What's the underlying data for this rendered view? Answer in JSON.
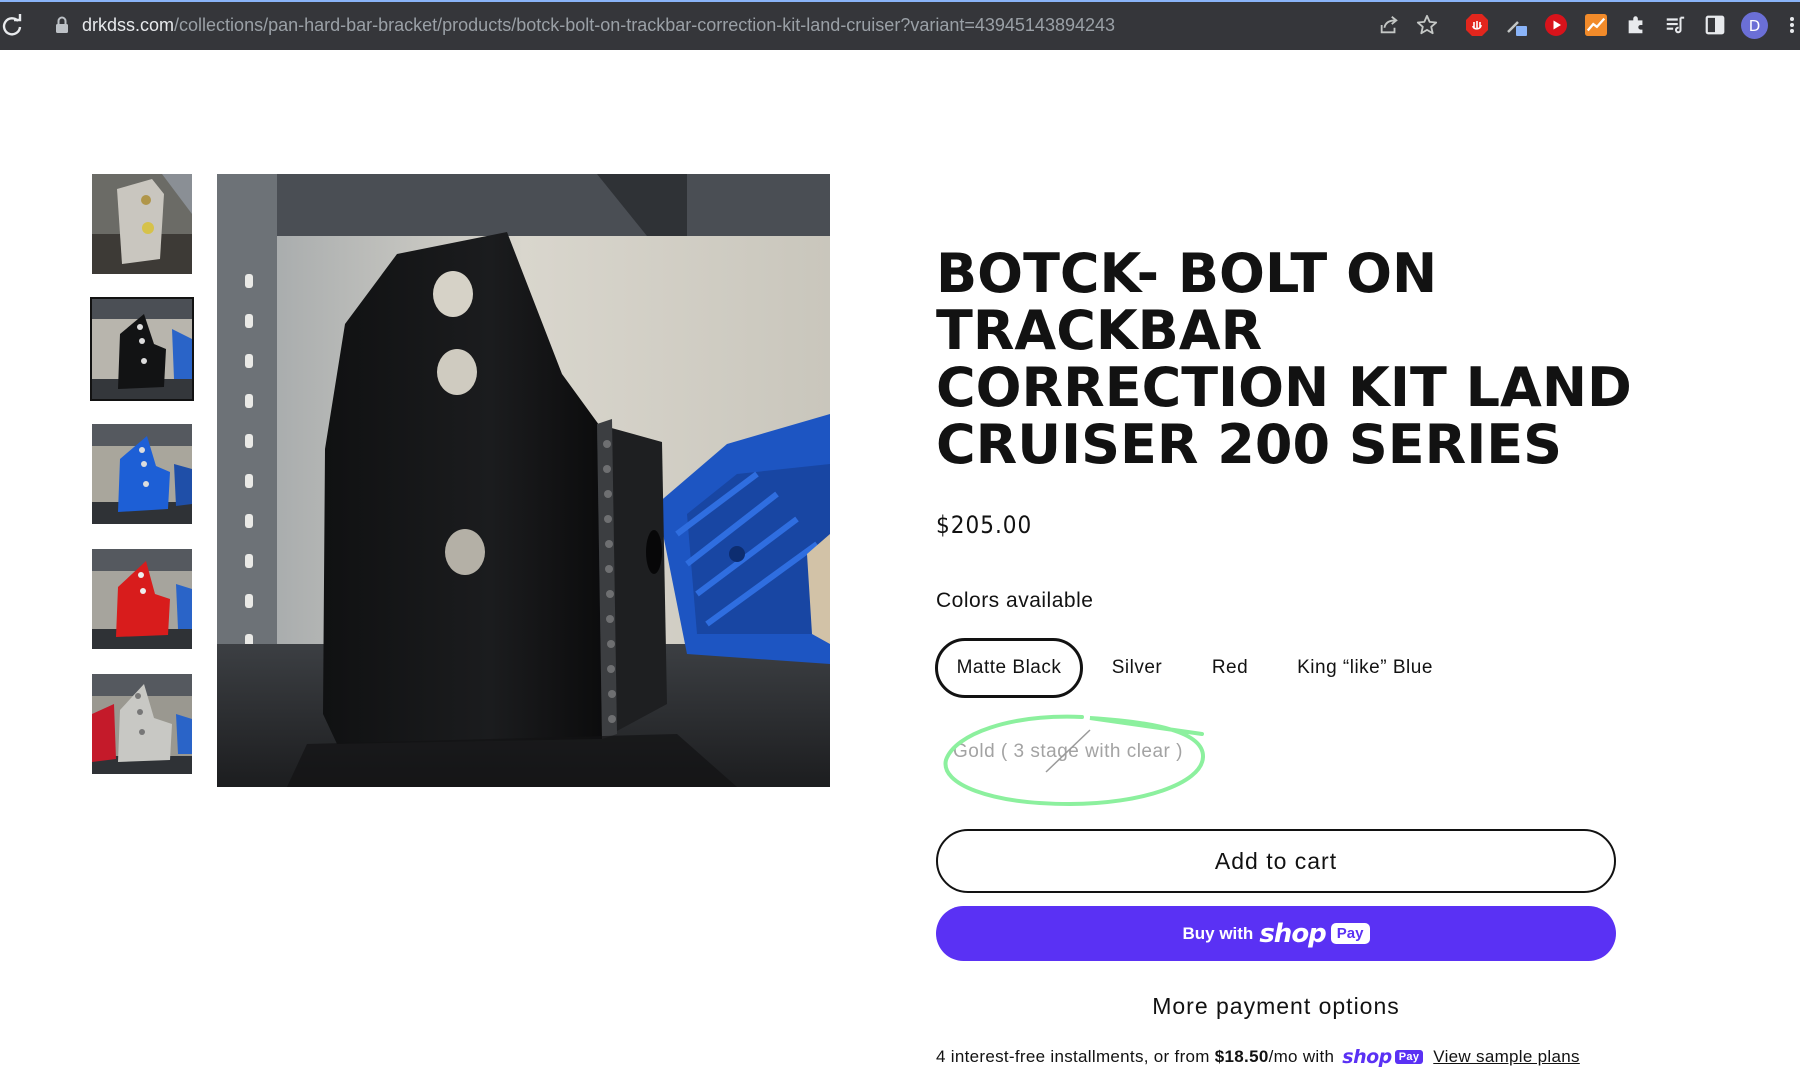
{
  "browser": {
    "url_domain": "drkdss.com",
    "url_path": "/collections/pan-hard-bar-bracket/products/botck-bolt-on-trackbar-correction-kit-land-cruiser?variant=43945143894243",
    "toolbar_icons": [
      "share-icon",
      "star-icon",
      "adblock-icon",
      "eyedropper-icon",
      "youtube-icon",
      "chart-icon",
      "puzzle-icon",
      "reading-list-icon",
      "side-panel-icon"
    ],
    "avatar_letter": "D"
  },
  "gallery": {
    "thumbnails": [
      "silver-bracket",
      "black-bracket",
      "blue-bracket",
      "red-bracket",
      "silver-red-bracket"
    ],
    "active_index": 1
  },
  "product": {
    "title": "BOTCK- BOLT ON TRACKBAR CORRECTION KIT LAND CRUISER 200 SERIES",
    "price": "$205.00",
    "colors_label": "Colors available",
    "colors": [
      {
        "label": "Matte Black",
        "state": "selected"
      },
      {
        "label": "Silver",
        "state": "available"
      },
      {
        "label": "Red",
        "state": "available"
      },
      {
        "label": "King “like” Blue",
        "state": "available"
      },
      {
        "label": "Gold ( 3 stage with clear )",
        "state": "sold-out"
      }
    ],
    "add_to_cart": "Add to cart",
    "buy_with": "Buy with",
    "shop_word": "shop",
    "pay_badge": "Pay",
    "more_payment": "More payment options",
    "installments": {
      "prefix": "4 interest-free installments, or from",
      "amount": "$18.50",
      "suffix": "/mo with",
      "shop_word": "shop",
      "pay_badge": "Pay",
      "link": "View sample plans"
    }
  },
  "colors": {
    "chrome_bg": "#35363a",
    "shop_pay_purple": "#5a31f4",
    "annotation_green": "#90f0a0",
    "text": "#121212"
  }
}
